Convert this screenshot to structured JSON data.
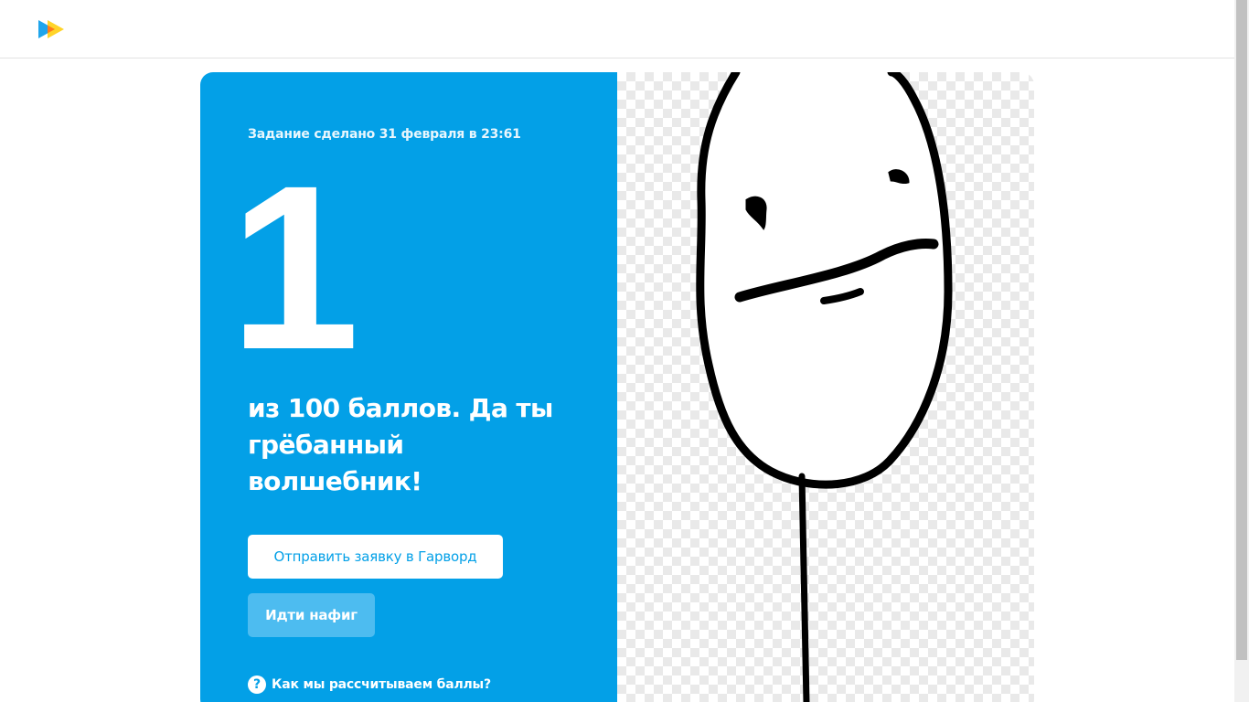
{
  "header": {
    "logo_icon": "play-arrows-logo-icon"
  },
  "result": {
    "completed_text": "Задание сделано 31 февраля в 23:61",
    "score": "1",
    "score_message": "из 100 баллов. Да ты грёбанный волшебник!",
    "apply_button_label": "Отправить заявку в Гарворд",
    "leave_button_label": "Идти нафиг",
    "help_icon_glyph": "?",
    "help_link_label": "Как мы рассчитываем баллы?"
  },
  "image": {
    "icon": "poker-face-meme-drawing"
  },
  "colors": {
    "accent": "#03a0e7",
    "secondary_button": "#4dbcf0"
  }
}
